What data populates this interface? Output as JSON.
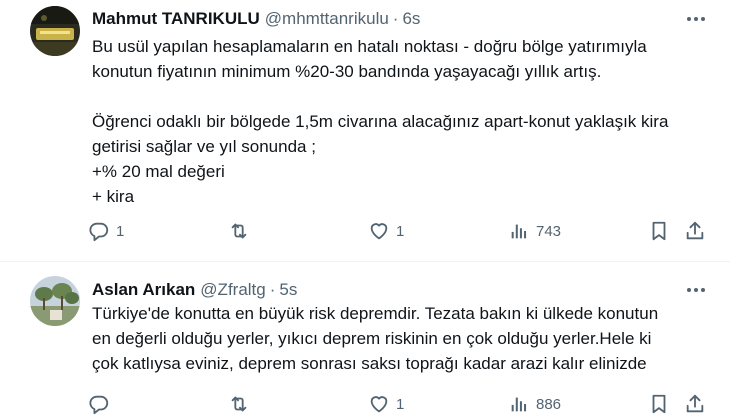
{
  "tweets": [
    {
      "author": {
        "name": "Mahmut TANRIKULU",
        "handle": "@mhmttanrikulu"
      },
      "time": "6s",
      "paragraphs": [
        "Bu usül yapılan hesaplamaların en hatalı noktası - doğru bölge yatırımıyla",
        "konutun fiyatının minimum %20-30 bandında yaşayacağı yıllık artış.",
        "",
        "Öğrenci odaklı bir bölgede 1,5m civarına alacağınız apart-konut yaklaşık kira",
        "getirisi sağlar ve yıl sonunda ;",
        "+% 20 mal değeri",
        "+ kira"
      ],
      "actions": {
        "replies": "1",
        "retweets": "",
        "likes": "1",
        "views": "743"
      }
    },
    {
      "author": {
        "name": "Aslan Arıkan",
        "handle": "@Zfraltg"
      },
      "time": "5s",
      "paragraphs": [
        "Türkiye'de konutta en büyük risk depremdir. Tezata bakın ki ülkede konutun",
        "en değerli olduğu yerler, yıkıcı deprem riskinin en çok olduğu yerler.Hele ki",
        "çok katlıysa eviniz, deprem sonrası saksı toprağı kadar arazi kalır elinizde"
      ],
      "actions": {
        "replies": "",
        "retweets": "",
        "likes": "1",
        "views": "886"
      }
    }
  ],
  "icons": {
    "reply": "reply-icon",
    "retweet": "retweet-icon",
    "like": "heart-icon",
    "views": "views-icon",
    "bookmark": "bookmark-icon",
    "share": "share-icon",
    "more": "more-icon"
  },
  "colors": {
    "text": "#0f1419",
    "secondary": "#536471",
    "divider": "#eff3f4"
  }
}
